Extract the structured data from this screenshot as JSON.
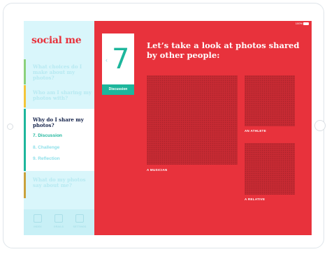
{
  "status": {
    "battery": "100%"
  },
  "app": {
    "logo": "social me"
  },
  "sidebar": {
    "questions": [
      {
        "label": "What choices do I make about my photos?",
        "color": "#8bd17c"
      },
      {
        "label": "Who am I sharing my photos with?",
        "color": "#f3c53a"
      },
      {
        "label": "Why do I share my photos?",
        "color": "#1db69c"
      },
      {
        "label": "What do my photos say about me?",
        "color": "#c9a13c"
      }
    ],
    "subnav": [
      {
        "label": "7. Discussion"
      },
      {
        "label": "8. Challenge"
      },
      {
        "label": "9. Reflection"
      }
    ],
    "toolbar": [
      {
        "label": "INDEX",
        "icon": "index-icon"
      },
      {
        "label": "GRAILS",
        "icon": "grails-icon"
      },
      {
        "label": "SETTINGS",
        "icon": "settings-icon"
      }
    ]
  },
  "step": {
    "number": "7",
    "label": "Discussion",
    "prev_icon": "chevron-left-icon"
  },
  "main": {
    "headline": "Let’s take a look at photos shared by other people:",
    "photos": [
      {
        "caption": "A MUSICIAN"
      },
      {
        "caption": "AN ATHLETE"
      },
      {
        "caption": "A RELATIVE"
      }
    ]
  },
  "colors": {
    "accent": "#e8323c",
    "teal": "#1db69c",
    "sidebar": "#d9f6fb",
    "navy": "#14224a"
  }
}
